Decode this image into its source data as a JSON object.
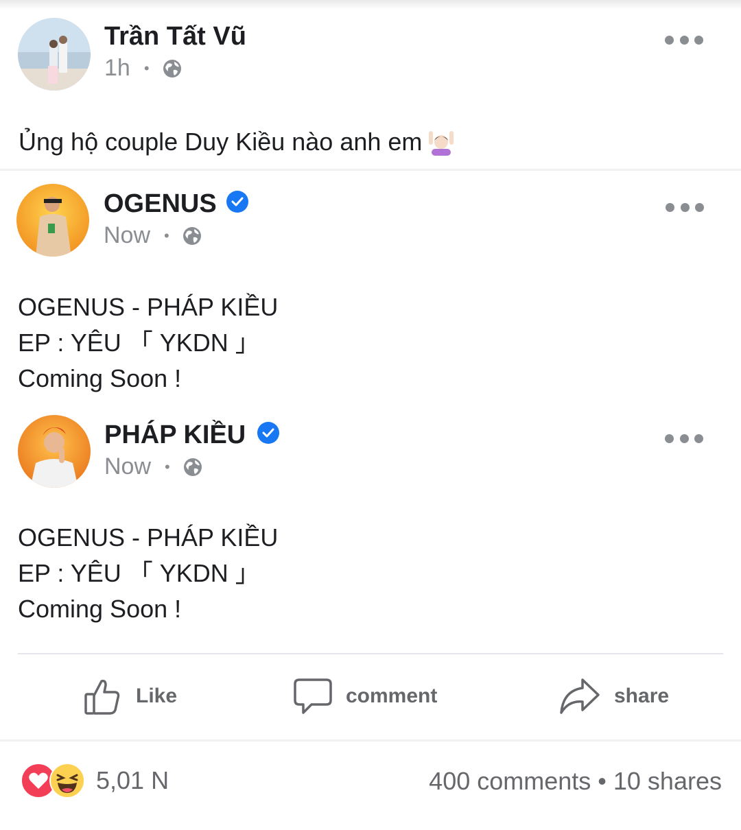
{
  "post": {
    "author": "Trần Tất Vũ",
    "time": "1h",
    "separator": "•",
    "caption": "Ủng hộ couple Duy Kiều nào anh em"
  },
  "shared": [
    {
      "author": "OGENUS",
      "time": "Now",
      "lines": [
        "OGENUS - PHÁP KIỀU",
        "EP : YÊU 「 YKDN 」",
        "Coming Soon !"
      ]
    },
    {
      "author": "PHÁP KIỀU",
      "time": "Now",
      "lines": [
        "OGENUS - PHÁP KIỀU",
        "EP : YÊU 「 YKDN 」",
        "Coming Soon !"
      ]
    }
  ],
  "actions": {
    "like": "Like",
    "comment": "comment",
    "share": "share"
  },
  "footer": {
    "reactions_count": "5,01 N",
    "stats": "400  comments • 10  shares"
  },
  "icons": {
    "privacy": "globe-icon",
    "verified": "verified-badge-icon",
    "more": "more-options-icon",
    "reactions": [
      "heart-reaction-icon",
      "haha-reaction-icon"
    ]
  },
  "colors": {
    "verified": "#1877f2",
    "meta": "#8a8d91",
    "action": "#65676b"
  }
}
